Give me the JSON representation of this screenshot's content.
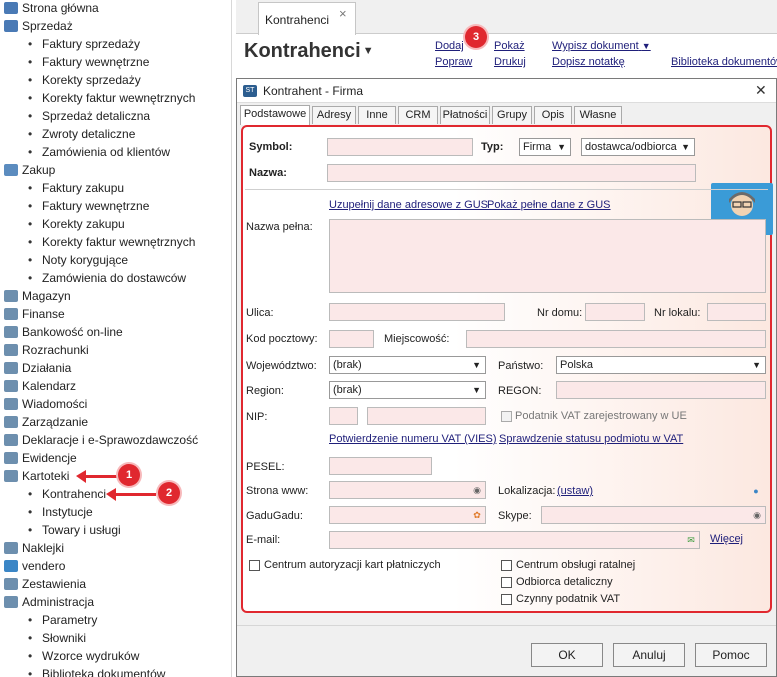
{
  "sidebar": {
    "items": [
      {
        "label": "Strona główna",
        "level": 0,
        "icon": "home-icon",
        "color": "#4a7ab5"
      },
      {
        "label": "Sprzedaż",
        "level": 0,
        "icon": "sales-icon",
        "color": "#4a7ab5"
      },
      {
        "label": "Faktury sprzedaży",
        "level": 1
      },
      {
        "label": "Faktury wewnętrzne",
        "level": 1
      },
      {
        "label": "Korekty sprzedaży",
        "level": 1
      },
      {
        "label": "Korekty faktur wewnętrznych",
        "level": 1
      },
      {
        "label": "Sprzedaż detaliczna",
        "level": 1
      },
      {
        "label": "Zwroty detaliczne",
        "level": 1
      },
      {
        "label": "Zamówienia od klientów",
        "level": 1
      },
      {
        "label": "Zakup",
        "level": 0,
        "icon": "purchase-icon",
        "color": "#5b8cbf"
      },
      {
        "label": "Faktury zakupu",
        "level": 1
      },
      {
        "label": "Faktury wewnętrzne",
        "level": 1
      },
      {
        "label": "Korekty zakupu",
        "level": 1
      },
      {
        "label": "Korekty faktur wewnętrznych",
        "level": 1
      },
      {
        "label": "Noty korygujące",
        "level": 1
      },
      {
        "label": "Zamówienia do dostawców",
        "level": 1
      },
      {
        "label": "Magazyn",
        "level": 0,
        "icon": "warehouse-icon",
        "color": "#6d8fae"
      },
      {
        "label": "Finanse",
        "level": 0,
        "icon": "finance-icon",
        "color": "#6d8fae"
      },
      {
        "label": "Bankowość on-line",
        "level": 0,
        "icon": "bank-icon",
        "color": "#6d8fae"
      },
      {
        "label": "Rozrachunki",
        "level": 0,
        "icon": "settlements-icon",
        "color": "#6d8fae"
      },
      {
        "label": "Działania",
        "level": 0,
        "icon": "actions-icon",
        "color": "#6d8fae"
      },
      {
        "label": "Kalendarz",
        "level": 0,
        "icon": "calendar-icon",
        "color": "#6d8fae"
      },
      {
        "label": "Wiadomości",
        "level": 0,
        "icon": "messages-icon",
        "color": "#6d8fae"
      },
      {
        "label": "Zarządzanie",
        "level": 0,
        "icon": "management-icon",
        "color": "#6d8fae"
      },
      {
        "label": "Deklaracje i e-Sprawozdawczość",
        "level": 0,
        "icon": "declarations-icon",
        "color": "#6d8fae"
      },
      {
        "label": "Ewidencje",
        "level": 0,
        "icon": "records-icon",
        "color": "#6d8fae"
      },
      {
        "label": "Kartoteki",
        "level": 0,
        "icon": "files-icon",
        "color": "#6d8fae"
      },
      {
        "label": "Kontrahenci",
        "level": 1
      },
      {
        "label": "Instytucje",
        "level": 1
      },
      {
        "label": "Towary i usługi",
        "level": 1
      },
      {
        "label": "Naklejki",
        "level": 0,
        "icon": "labels-icon",
        "color": "#6d8fae"
      },
      {
        "label": "vendero",
        "level": 0,
        "icon": "vendero-icon",
        "color": "#3b86c6"
      },
      {
        "label": "Zestawienia",
        "level": 0,
        "icon": "reports-icon",
        "color": "#6d8fae"
      },
      {
        "label": "Administracja",
        "level": 0,
        "icon": "admin-icon",
        "color": "#6d8fae"
      },
      {
        "label": "Parametry",
        "level": 1
      },
      {
        "label": "Słowniki",
        "level": 1
      },
      {
        "label": "Wzorce wydruków",
        "level": 1
      },
      {
        "label": "Biblioteka dokumentów",
        "level": 1
      }
    ]
  },
  "doc_tab": {
    "label": "Kontrahenci",
    "close": "×"
  },
  "page_title": "Kontrahenci",
  "toolbar": {
    "dodaj": "Dodaj",
    "popraw": "Popraw",
    "pokaz": "Pokaż",
    "drukuj": "Drukuj",
    "wypisz": "Wypisz dokument",
    "dopisz": "Dopisz notatkę",
    "biblioteka": "Biblioteka dokumentów"
  },
  "badges": {
    "b1": "1",
    "b2": "2",
    "b3": "3",
    "accent": "#e0282f"
  },
  "dialog": {
    "title": "Kontrahent - Firma",
    "close": "✕",
    "tabs": [
      "Podstawowe",
      "Adresy",
      "Inne",
      "CRM",
      "Płatności",
      "Grupy",
      "Opis",
      "Własne"
    ],
    "active_tab": "Podstawowe",
    "labels": {
      "symbol": "Symbol:",
      "typ": "Typ:",
      "nazwa": "Nazwa:",
      "nazwa_pelna": "Nazwa pełna:",
      "ulica": "Ulica:",
      "nr_domu": "Nr domu:",
      "nr_lokalu": "Nr lokalu:",
      "kod": "Kod pocztowy:",
      "miejscowosc": "Miejscowość:",
      "wojewodztwo": "Województwo:",
      "panstwo": "Państwo:",
      "region": "Region:",
      "regon": "REGON:",
      "nip": "NIP:",
      "vat_cb": "Podatnik VAT zarejestrowany w UE",
      "pesel": "PESEL:",
      "www": "Strona www:",
      "lokalizacja": "Lokalizacja:",
      "gg": "GaduGadu:",
      "skype": "Skype:",
      "email": "E-mail:"
    },
    "values": {
      "typ": "Firma",
      "rola": "dostawca/odbiorca",
      "wojewodztwo": "(brak)",
      "panstwo": "Polska",
      "region": "(brak)"
    },
    "links": {
      "gus_fill": "Uzupełnij dane adresowe z GUS",
      "gus_show": "Pokaż pełne dane z GUS",
      "vies": "Potwierdzenie numeru VAT (VIES)",
      "vat_status": "Sprawdzenie statusu podmiotu w VAT",
      "ustaw": "(ustaw)",
      "wiecej": "Więcej"
    },
    "checkboxes": {
      "centrum_kart": "Centrum autoryzacji kart płatniczych",
      "centrum_ratalne": "Centrum obsługi ratalnej",
      "odbiorca_det": "Odbiorca detaliczny",
      "czynny_vat": "Czynny podatnik VAT"
    },
    "buttons": {
      "ok": "OK",
      "anuluj": "Anuluj",
      "pomoc": "Pomoc"
    }
  }
}
